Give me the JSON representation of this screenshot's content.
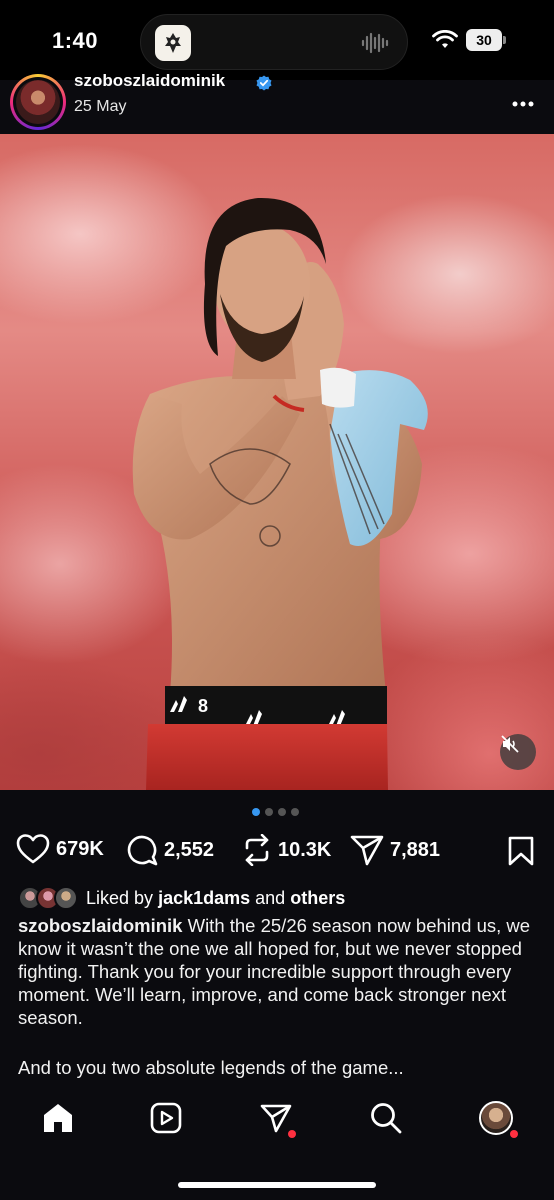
{
  "status_bar": {
    "time": "1:40",
    "battery": "30"
  },
  "post": {
    "username": "szoboszlaidominik",
    "date": "25 May",
    "slides": 4,
    "active_slide": 1
  },
  "actions": {
    "likes": "679K",
    "comments": "2,552",
    "reposts": "10.3K",
    "shares": "7,881"
  },
  "liked_by": {
    "prefix": "Liked by",
    "user": "jack1dams",
    "connector": "and",
    "others": "others"
  },
  "caption": {
    "user": "szoboszlaidominik",
    "text": "With the 25/26 season now behind us, we know it wasn’t the one we all hoped for, but we never stopped fighting. Thank you for your incredible support through every moment. We’ll learn, improve, and come back stronger next season.",
    "second_paragraph": "And to you two absolute legends of the game..."
  },
  "photo": {
    "shirt_number": "8"
  },
  "colors": {
    "accent": "#3797f0",
    "notification": "#ff3040",
    "background": "#0b0b0f"
  },
  "icons": [
    "heart-icon",
    "comment-icon",
    "repost-icon",
    "share-icon",
    "bookmark-icon",
    "home-icon",
    "reels-icon",
    "send-icon",
    "search-icon",
    "profile-avatar",
    "mute-icon",
    "verified-icon",
    "more-icon"
  ]
}
